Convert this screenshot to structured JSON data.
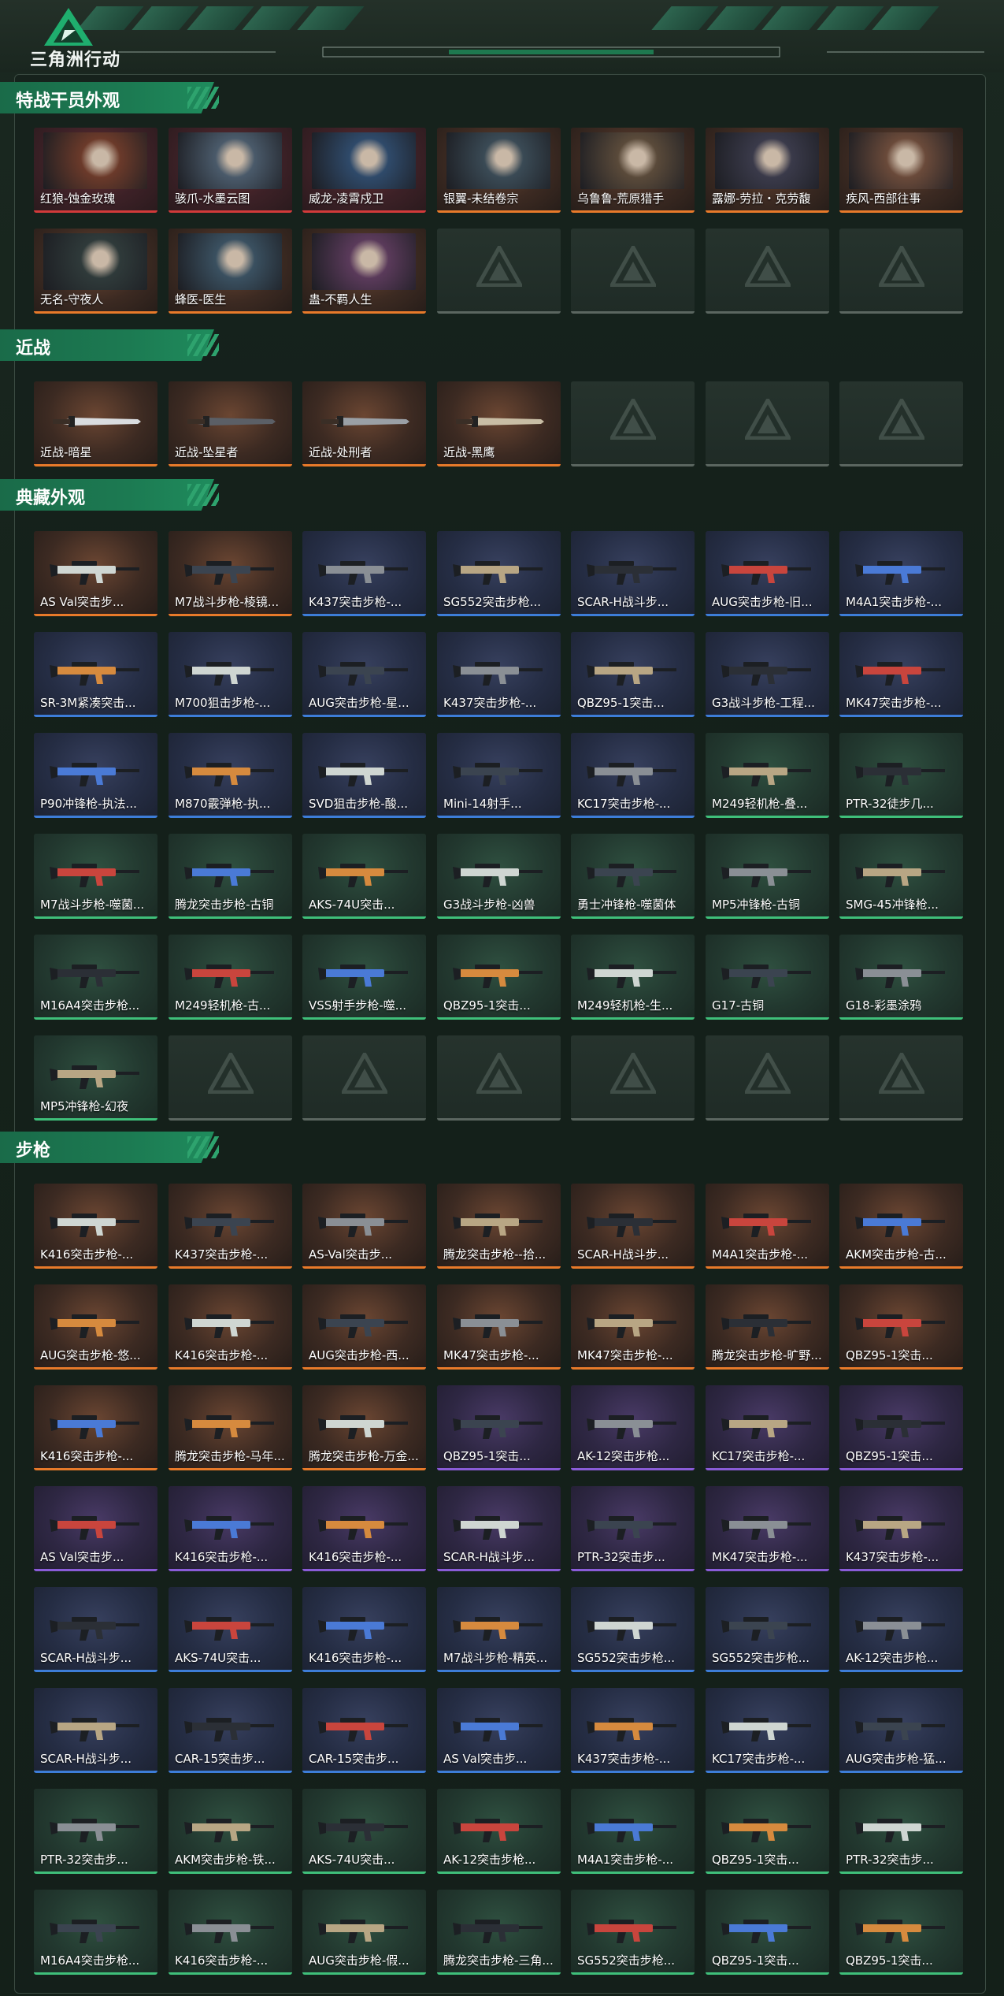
{
  "header": {
    "logo_text": "三角洲行动"
  },
  "colors": {
    "accent": "#1c7a52",
    "orange": "#e87a2a",
    "red": "#d23a3a",
    "blue": "#3d7dd8",
    "purple": "#8a5cd8",
    "green": "#3fbf7a"
  },
  "sections": [
    {
      "title": "特战干员外观",
      "items": [
        {
          "label": "红狼-蚀金玫瑰",
          "rarity": "red",
          "kind": "operator"
        },
        {
          "label": "骇爪-水墨云图",
          "rarity": "red",
          "kind": "operator"
        },
        {
          "label": "威龙-凌霄戍卫",
          "rarity": "red",
          "kind": "operator"
        },
        {
          "label": "银翼-未结卷宗",
          "rarity": "orange",
          "kind": "operator"
        },
        {
          "label": "乌鲁鲁-荒原猎手",
          "rarity": "orange",
          "kind": "operator"
        },
        {
          "label": "露娜-劳拉・克劳馥",
          "rarity": "orange",
          "kind": "operator"
        },
        {
          "label": "疾风-西部往事",
          "rarity": "orange",
          "kind": "operator"
        },
        {
          "label": "无名-守夜人",
          "rarity": "orange",
          "kind": "operator"
        },
        {
          "label": "蜂医-医生",
          "rarity": "orange",
          "kind": "operator"
        },
        {
          "label": "蛊-不羁人生",
          "rarity": "orange",
          "kind": "operator"
        },
        {
          "label": "",
          "rarity": "empty",
          "kind": "empty"
        },
        {
          "label": "",
          "rarity": "empty",
          "kind": "empty"
        },
        {
          "label": "",
          "rarity": "empty",
          "kind": "empty"
        },
        {
          "label": "",
          "rarity": "empty",
          "kind": "empty"
        }
      ]
    },
    {
      "title": "近战",
      "items": [
        {
          "label": "近战-暗星",
          "rarity": "orange",
          "kind": "melee"
        },
        {
          "label": "近战-坠星者",
          "rarity": "orange",
          "kind": "melee"
        },
        {
          "label": "近战-处刑者",
          "rarity": "orange",
          "kind": "melee"
        },
        {
          "label": "近战-黑鹰",
          "rarity": "orange",
          "kind": "melee"
        },
        {
          "label": "",
          "rarity": "empty",
          "kind": "empty"
        },
        {
          "label": "",
          "rarity": "empty",
          "kind": "empty"
        },
        {
          "label": "",
          "rarity": "empty",
          "kind": "empty"
        }
      ]
    },
    {
      "title": "典藏外观",
      "items": [
        {
          "label": "AS Val突击步...",
          "rarity": "orange",
          "kind": "gun"
        },
        {
          "label": "M7战斗步枪-棱镜...",
          "rarity": "orange",
          "kind": "gun"
        },
        {
          "label": "K437突击步枪-...",
          "rarity": "blue",
          "kind": "gun"
        },
        {
          "label": "SG552突击步枪...",
          "rarity": "blue",
          "kind": "gun"
        },
        {
          "label": "SCAR-H战斗步...",
          "rarity": "blue",
          "kind": "gun"
        },
        {
          "label": "AUG突击步枪-旧...",
          "rarity": "blue",
          "kind": "gun"
        },
        {
          "label": "M4A1突击步枪-...",
          "rarity": "blue",
          "kind": "gun"
        },
        {
          "label": "SR-3M紧凑突击...",
          "rarity": "blue",
          "kind": "gun"
        },
        {
          "label": "M700狙击步枪-...",
          "rarity": "blue",
          "kind": "gun"
        },
        {
          "label": "AUG突击步枪-星...",
          "rarity": "blue",
          "kind": "gun"
        },
        {
          "label": "K437突击步枪-...",
          "rarity": "blue",
          "kind": "gun"
        },
        {
          "label": "QBZ95-1突击...",
          "rarity": "blue",
          "kind": "gun"
        },
        {
          "label": "G3战斗步枪-工程...",
          "rarity": "blue",
          "kind": "gun"
        },
        {
          "label": "MK47突击步枪-...",
          "rarity": "blue",
          "kind": "gun"
        },
        {
          "label": "P90冲锋枪-执法...",
          "rarity": "blue",
          "kind": "gun"
        },
        {
          "label": "M870霰弹枪-执...",
          "rarity": "blue",
          "kind": "gun"
        },
        {
          "label": "SVD狙击步枪-酸...",
          "rarity": "blue",
          "kind": "gun"
        },
        {
          "label": "Mini-14射手...",
          "rarity": "blue",
          "kind": "gun"
        },
        {
          "label": "KC17突击步枪-...",
          "rarity": "blue",
          "kind": "gun"
        },
        {
          "label": "M249轻机枪-叠...",
          "rarity": "green",
          "kind": "gun"
        },
        {
          "label": "PTR-32徒步几...",
          "rarity": "green",
          "kind": "gun"
        },
        {
          "label": "M7战斗步枪-噬菌...",
          "rarity": "green",
          "kind": "gun"
        },
        {
          "label": "腾龙突击步枪-古铜",
          "rarity": "green",
          "kind": "gun"
        },
        {
          "label": "AKS-74U突击...",
          "rarity": "green",
          "kind": "gun"
        },
        {
          "label": "G3战斗步枪-凶兽",
          "rarity": "green",
          "kind": "gun"
        },
        {
          "label": "勇士冲锋枪-噬菌体",
          "rarity": "green",
          "kind": "gun"
        },
        {
          "label": "MP5冲锋枪-古铜",
          "rarity": "green",
          "kind": "gun"
        },
        {
          "label": "SMG-45冲锋枪...",
          "rarity": "green",
          "kind": "gun"
        },
        {
          "label": "M16A4突击步枪...",
          "rarity": "green",
          "kind": "gun"
        },
        {
          "label": "M249轻机枪-古...",
          "rarity": "green",
          "kind": "gun"
        },
        {
          "label": "VSS射手步枪-噬...",
          "rarity": "green",
          "kind": "gun"
        },
        {
          "label": "QBZ95-1突击...",
          "rarity": "green",
          "kind": "gun"
        },
        {
          "label": "M249轻机枪-生...",
          "rarity": "green",
          "kind": "gun"
        },
        {
          "label": "G17-古铜",
          "rarity": "green",
          "kind": "gun"
        },
        {
          "label": "G18-彩墨涂鸦",
          "rarity": "green",
          "kind": "gun"
        },
        {
          "label": "MP5冲锋枪-幻夜",
          "rarity": "green",
          "kind": "gun"
        },
        {
          "label": "",
          "rarity": "empty",
          "kind": "empty"
        },
        {
          "label": "",
          "rarity": "empty",
          "kind": "empty"
        },
        {
          "label": "",
          "rarity": "empty",
          "kind": "empty"
        },
        {
          "label": "",
          "rarity": "empty",
          "kind": "empty"
        },
        {
          "label": "",
          "rarity": "empty",
          "kind": "empty"
        },
        {
          "label": "",
          "rarity": "empty",
          "kind": "empty"
        }
      ]
    },
    {
      "title": "步枪",
      "items": [
        {
          "label": "K416突击步枪-...",
          "rarity": "orange",
          "kind": "gun"
        },
        {
          "label": "K437突击步枪-...",
          "rarity": "orange",
          "kind": "gun"
        },
        {
          "label": "AS-Val突击步...",
          "rarity": "orange",
          "kind": "gun"
        },
        {
          "label": "腾龙突击步枪--拾...",
          "rarity": "orange",
          "kind": "gun"
        },
        {
          "label": "SCAR-H战斗步...",
          "rarity": "orange",
          "kind": "gun"
        },
        {
          "label": "M4A1突击步枪-...",
          "rarity": "orange",
          "kind": "gun"
        },
        {
          "label": "AKM突击步枪-古...",
          "rarity": "orange",
          "kind": "gun"
        },
        {
          "label": "AUG突击步枪-悠...",
          "rarity": "orange",
          "kind": "gun"
        },
        {
          "label": "K416突击步枪-...",
          "rarity": "orange",
          "kind": "gun"
        },
        {
          "label": "AUG突击步枪-西...",
          "rarity": "orange",
          "kind": "gun"
        },
        {
          "label": "MK47突击步枪-...",
          "rarity": "orange",
          "kind": "gun"
        },
        {
          "label": "MK47突击步枪-...",
          "rarity": "orange",
          "kind": "gun"
        },
        {
          "label": "腾龙突击步枪-旷野...",
          "rarity": "orange",
          "kind": "gun"
        },
        {
          "label": "QBZ95-1突击...",
          "rarity": "orange",
          "kind": "gun"
        },
        {
          "label": "K416突击步枪-...",
          "rarity": "orange",
          "kind": "gun"
        },
        {
          "label": "腾龙突击步枪-马年...",
          "rarity": "orange",
          "kind": "gun"
        },
        {
          "label": "腾龙突击步枪-万金...",
          "rarity": "orange",
          "kind": "gun"
        },
        {
          "label": "QBZ95-1突击...",
          "rarity": "purple",
          "kind": "gun"
        },
        {
          "label": "AK-12突击步枪...",
          "rarity": "purple",
          "kind": "gun"
        },
        {
          "label": "KC17突击步枪-...",
          "rarity": "purple",
          "kind": "gun"
        },
        {
          "label": "QBZ95-1突击...",
          "rarity": "purple",
          "kind": "gun"
        },
        {
          "label": "AS Val突击步...",
          "rarity": "purple",
          "kind": "gun"
        },
        {
          "label": "K416突击步枪-...",
          "rarity": "purple",
          "kind": "gun"
        },
        {
          "label": "K416突击步枪-...",
          "rarity": "purple",
          "kind": "gun"
        },
        {
          "label": "SCAR-H战斗步...",
          "rarity": "purple",
          "kind": "gun"
        },
        {
          "label": "PTR-32突击步...",
          "rarity": "purple",
          "kind": "gun"
        },
        {
          "label": "MK47突击步枪-...",
          "rarity": "purple",
          "kind": "gun"
        },
        {
          "label": "K437突击步枪-...",
          "rarity": "purple",
          "kind": "gun"
        },
        {
          "label": "SCAR-H战斗步...",
          "rarity": "blue",
          "kind": "gun"
        },
        {
          "label": "AKS-74U突击...",
          "rarity": "blue",
          "kind": "gun"
        },
        {
          "label": "K416突击步枪-...",
          "rarity": "blue",
          "kind": "gun"
        },
        {
          "label": "M7战斗步枪-精英...",
          "rarity": "blue",
          "kind": "gun"
        },
        {
          "label": "SG552突击步枪...",
          "rarity": "blue",
          "kind": "gun"
        },
        {
          "label": "SG552突击步枪...",
          "rarity": "blue",
          "kind": "gun"
        },
        {
          "label": "AK-12突击步枪...",
          "rarity": "blue",
          "kind": "gun"
        },
        {
          "label": "SCAR-H战斗步...",
          "rarity": "blue",
          "kind": "gun"
        },
        {
          "label": "CAR-15突击步...",
          "rarity": "blue",
          "kind": "gun"
        },
        {
          "label": "CAR-15突击步...",
          "rarity": "blue",
          "kind": "gun"
        },
        {
          "label": "AS Val突击步...",
          "rarity": "blue",
          "kind": "gun"
        },
        {
          "label": "K437突击步枪-...",
          "rarity": "blue",
          "kind": "gun"
        },
        {
          "label": "KC17突击步枪-...",
          "rarity": "blue",
          "kind": "gun"
        },
        {
          "label": "AUG突击步枪-猛...",
          "rarity": "blue",
          "kind": "gun"
        },
        {
          "label": "PTR-32突击步...",
          "rarity": "green",
          "kind": "gun"
        },
        {
          "label": "AKM突击步枪-铁...",
          "rarity": "green",
          "kind": "gun"
        },
        {
          "label": "AKS-74U突击...",
          "rarity": "green",
          "kind": "gun"
        },
        {
          "label": "AK-12突击步枪...",
          "rarity": "green",
          "kind": "gun"
        },
        {
          "label": "M4A1突击步枪-...",
          "rarity": "green",
          "kind": "gun"
        },
        {
          "label": "QBZ95-1突击...",
          "rarity": "green",
          "kind": "gun"
        },
        {
          "label": "PTR-32突击步...",
          "rarity": "green",
          "kind": "gun"
        },
        {
          "label": "M16A4突击步枪...",
          "rarity": "green",
          "kind": "gun"
        },
        {
          "label": "K416突击步枪-...",
          "rarity": "green",
          "kind": "gun"
        },
        {
          "label": "AUG突击步枪-假...",
          "rarity": "green",
          "kind": "gun"
        },
        {
          "label": "腾龙突击步枪-三角...",
          "rarity": "green",
          "kind": "gun"
        },
        {
          "label": "SG552突击步枪...",
          "rarity": "green",
          "kind": "gun"
        },
        {
          "label": "QBZ95-1突击...",
          "rarity": "green",
          "kind": "gun"
        },
        {
          "label": "QBZ95-1突击...",
          "rarity": "green",
          "kind": "gun"
        }
      ]
    }
  ]
}
